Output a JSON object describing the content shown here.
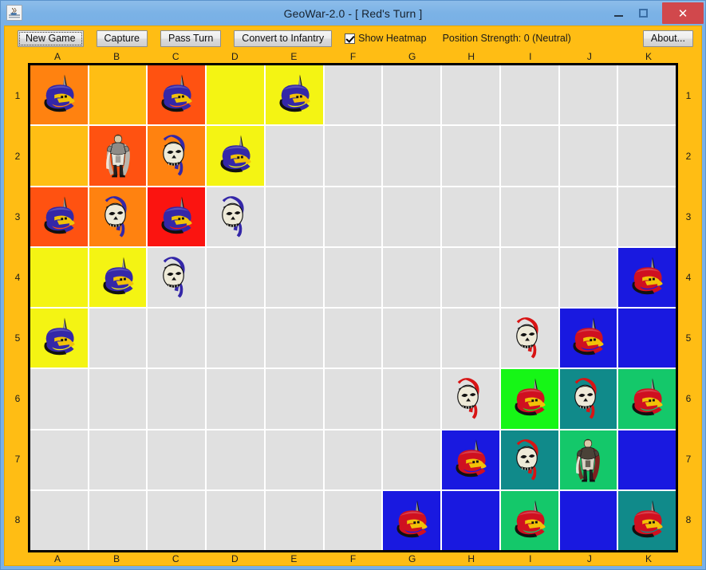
{
  "window": {
    "title": "GeoWar-2.0 - [ Red's Turn ]",
    "icon": "java-coffee-icon",
    "controls": {
      "minimize": "minimize-icon",
      "maximize": "maximize-icon",
      "close": "✕"
    }
  },
  "toolbar": {
    "new_game_label": "New Game",
    "capture_label": "Capture",
    "pass_turn_label": "Pass Turn",
    "convert_label": "Convert to Infantry",
    "heatmap_label": "Show Heatmap",
    "heatmap_checked": true,
    "status_label": "Position Strength: 0 (Neutral)",
    "about_label": "About..."
  },
  "board": {
    "columns": [
      "A",
      "B",
      "C",
      "D",
      "E",
      "F",
      "G",
      "H",
      "I",
      "J",
      "K"
    ],
    "rows": [
      "1",
      "2",
      "3",
      "4",
      "5",
      "6",
      "7",
      "8"
    ],
    "colors": {
      "empty": "#e0e0e0",
      "heat_amber": "#ffbe14",
      "heat_orange": "#ff8210",
      "heat_orange_red": "#ff5211",
      "heat_red": "#fb1410",
      "heat_yellow": "#f4f413",
      "heat_blue": "#1919e0",
      "heat_green_bright": "#16f616",
      "heat_green": "#14c86a",
      "heat_teal": "#108a8a",
      "board_border": "#000000",
      "panel_bg": "#ffbd14",
      "titlebar_bg": "#78b0e8",
      "close_btn": "#d1484c"
    },
    "cells": [
      [
        {
          "id": "A1",
          "bg": "heat_orange",
          "piece": "blue-helmet"
        },
        {
          "id": "B1",
          "bg": "heat_amber",
          "piece": null
        },
        {
          "id": "C1",
          "bg": "heat_orange_red",
          "piece": "blue-helmet"
        },
        {
          "id": "D1",
          "bg": "heat_yellow",
          "piece": null
        },
        {
          "id": "E1",
          "bg": "heat_yellow",
          "piece": "blue-helmet"
        },
        {
          "id": "F1",
          "bg": "empty",
          "piece": null
        },
        {
          "id": "G1",
          "bg": "empty",
          "piece": null
        },
        {
          "id": "H1",
          "bg": "empty",
          "piece": null
        },
        {
          "id": "I1",
          "bg": "empty",
          "piece": null
        },
        {
          "id": "J1",
          "bg": "empty",
          "piece": null
        },
        {
          "id": "K1",
          "bg": "empty",
          "piece": null
        }
      ],
      [
        {
          "id": "A2",
          "bg": "heat_amber",
          "piece": null
        },
        {
          "id": "B2",
          "bg": "heat_orange_red",
          "piece": "blue-king"
        },
        {
          "id": "C2",
          "bg": "heat_orange",
          "piece": "blue-skull"
        },
        {
          "id": "D2",
          "bg": "heat_yellow",
          "piece": "blue-helmet"
        },
        {
          "id": "E2",
          "bg": "empty",
          "piece": null
        },
        {
          "id": "F2",
          "bg": "empty",
          "piece": null
        },
        {
          "id": "G2",
          "bg": "empty",
          "piece": null
        },
        {
          "id": "H2",
          "bg": "empty",
          "piece": null
        },
        {
          "id": "I2",
          "bg": "empty",
          "piece": null
        },
        {
          "id": "J2",
          "bg": "empty",
          "piece": null
        },
        {
          "id": "K2",
          "bg": "empty",
          "piece": null
        }
      ],
      [
        {
          "id": "A3",
          "bg": "heat_orange_red",
          "piece": "blue-helmet"
        },
        {
          "id": "B3",
          "bg": "heat_orange",
          "piece": "blue-skull"
        },
        {
          "id": "C3",
          "bg": "heat_red",
          "piece": "blue-helmet"
        },
        {
          "id": "D3",
          "bg": "empty",
          "piece": "blue-skull"
        },
        {
          "id": "E3",
          "bg": "empty",
          "piece": null
        },
        {
          "id": "F3",
          "bg": "empty",
          "piece": null
        },
        {
          "id": "G3",
          "bg": "empty",
          "piece": null
        },
        {
          "id": "H3",
          "bg": "empty",
          "piece": null
        },
        {
          "id": "I3",
          "bg": "empty",
          "piece": null
        },
        {
          "id": "J3",
          "bg": "empty",
          "piece": null
        },
        {
          "id": "K3",
          "bg": "empty",
          "piece": null
        }
      ],
      [
        {
          "id": "A4",
          "bg": "heat_yellow",
          "piece": null
        },
        {
          "id": "B4",
          "bg": "heat_yellow",
          "piece": "blue-helmet"
        },
        {
          "id": "C4",
          "bg": "empty",
          "piece": "blue-skull"
        },
        {
          "id": "D4",
          "bg": "empty",
          "piece": null
        },
        {
          "id": "E4",
          "bg": "empty",
          "piece": null
        },
        {
          "id": "F4",
          "bg": "empty",
          "piece": null
        },
        {
          "id": "G4",
          "bg": "empty",
          "piece": null
        },
        {
          "id": "H4",
          "bg": "empty",
          "piece": null
        },
        {
          "id": "I4",
          "bg": "empty",
          "piece": null
        },
        {
          "id": "J4",
          "bg": "empty",
          "piece": null
        },
        {
          "id": "K4",
          "bg": "heat_blue",
          "piece": "red-helmet"
        }
      ],
      [
        {
          "id": "A5",
          "bg": "heat_yellow",
          "piece": "blue-helmet"
        },
        {
          "id": "B5",
          "bg": "empty",
          "piece": null
        },
        {
          "id": "C5",
          "bg": "empty",
          "piece": null
        },
        {
          "id": "D5",
          "bg": "empty",
          "piece": null
        },
        {
          "id": "E5",
          "bg": "empty",
          "piece": null
        },
        {
          "id": "F5",
          "bg": "empty",
          "piece": null
        },
        {
          "id": "G5",
          "bg": "empty",
          "piece": null
        },
        {
          "id": "H5",
          "bg": "empty",
          "piece": null
        },
        {
          "id": "I5",
          "bg": "empty",
          "piece": "red-skull"
        },
        {
          "id": "J5",
          "bg": "heat_blue",
          "piece": "red-helmet"
        },
        {
          "id": "K5",
          "bg": "heat_blue",
          "piece": null
        }
      ],
      [
        {
          "id": "A6",
          "bg": "empty",
          "piece": null
        },
        {
          "id": "B6",
          "bg": "empty",
          "piece": null
        },
        {
          "id": "C6",
          "bg": "empty",
          "piece": null
        },
        {
          "id": "D6",
          "bg": "empty",
          "piece": null
        },
        {
          "id": "E6",
          "bg": "empty",
          "piece": null
        },
        {
          "id": "F6",
          "bg": "empty",
          "piece": null
        },
        {
          "id": "G6",
          "bg": "empty",
          "piece": null
        },
        {
          "id": "H6",
          "bg": "empty",
          "piece": "red-skull"
        },
        {
          "id": "I6",
          "bg": "heat_green_bright",
          "piece": "red-helmet"
        },
        {
          "id": "J6",
          "bg": "heat_teal",
          "piece": "red-skull"
        },
        {
          "id": "K6",
          "bg": "heat_green",
          "piece": "red-helmet"
        }
      ],
      [
        {
          "id": "A7",
          "bg": "empty",
          "piece": null
        },
        {
          "id": "B7",
          "bg": "empty",
          "piece": null
        },
        {
          "id": "C7",
          "bg": "empty",
          "piece": null
        },
        {
          "id": "D7",
          "bg": "empty",
          "piece": null
        },
        {
          "id": "E7",
          "bg": "empty",
          "piece": null
        },
        {
          "id": "F7",
          "bg": "empty",
          "piece": null
        },
        {
          "id": "G7",
          "bg": "empty",
          "piece": null
        },
        {
          "id": "H7",
          "bg": "heat_blue",
          "piece": "red-helmet"
        },
        {
          "id": "I7",
          "bg": "heat_teal",
          "piece": "red-skull"
        },
        {
          "id": "J7",
          "bg": "heat_green",
          "piece": "red-king"
        },
        {
          "id": "K7",
          "bg": "heat_blue",
          "piece": null
        }
      ],
      [
        {
          "id": "A8",
          "bg": "empty",
          "piece": null
        },
        {
          "id": "B8",
          "bg": "empty",
          "piece": null
        },
        {
          "id": "C8",
          "bg": "empty",
          "piece": null
        },
        {
          "id": "D8",
          "bg": "empty",
          "piece": null
        },
        {
          "id": "E8",
          "bg": "empty",
          "piece": null
        },
        {
          "id": "F8",
          "bg": "empty",
          "piece": null
        },
        {
          "id": "G8",
          "bg": "heat_blue",
          "piece": "red-helmet"
        },
        {
          "id": "H8",
          "bg": "heat_blue",
          "piece": null
        },
        {
          "id": "I8",
          "bg": "heat_green",
          "piece": "red-helmet"
        },
        {
          "id": "J8",
          "bg": "heat_blue",
          "piece": null
        },
        {
          "id": "K8",
          "bg": "heat_teal",
          "piece": "red-helmet"
        }
      ]
    ]
  }
}
